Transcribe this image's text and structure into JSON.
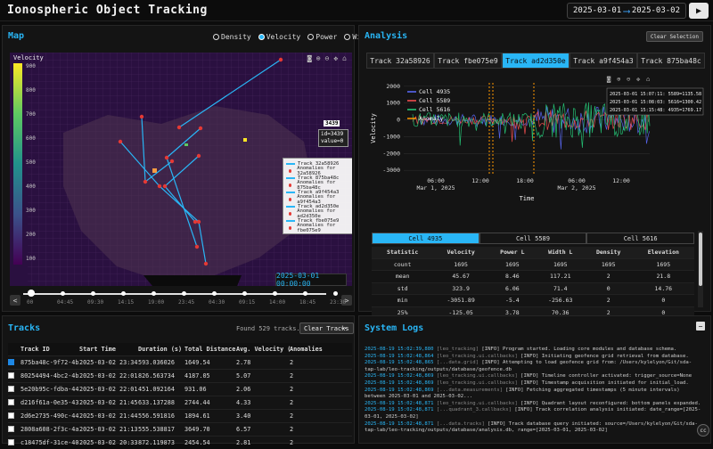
{
  "app": {
    "title": "Ionospheric Object Tracking"
  },
  "date_range": {
    "start": "2025-03-01",
    "end": "2025-03-02"
  },
  "map": {
    "title": "Map",
    "modes": [
      {
        "label": "Density",
        "selected": false
      },
      {
        "label": "Velocity",
        "selected": true
      },
      {
        "label": "Power",
        "selected": false
      },
      {
        "label": "Width",
        "selected": false
      }
    ],
    "colorbar_label": "Velocity",
    "colorbar_ticks": [
      "900",
      "800",
      "700",
      "600",
      "500",
      "400",
      "300",
      "200",
      "100"
    ],
    "tooltip": {
      "head": "3439",
      "line1": "id=3439",
      "line2": "value=0"
    },
    "legend": [
      {
        "label": "Track 32a58926",
        "kind": "line"
      },
      {
        "label": "Anomalies for 32a58926",
        "kind": "dot"
      },
      {
        "label": "Track 875ba48c",
        "kind": "line"
      },
      {
        "label": "Anomalies for 875ba48c",
        "kind": "dot"
      },
      {
        "label": "Track a9f454a3",
        "kind": "line"
      },
      {
        "label": "Anomalies for a9f454a3",
        "kind": "dot"
      },
      {
        "label": "Track ad2d350e",
        "kind": "line"
      },
      {
        "label": "Anomalies for ad2d350e",
        "kind": "dot"
      },
      {
        "label": "Track fbe075e9",
        "kind": "line"
      },
      {
        "label": "Anomalies for fbe075e9",
        "kind": "dot"
      }
    ],
    "time_display": "2025-03-01 00:00:00",
    "slider_labels": [
      "00",
      "04:45",
      "09:30",
      "14:15",
      "19:00",
      "23:45",
      "04:30",
      "09:15",
      "14:00",
      "18:45",
      "23:30"
    ],
    "slider_prev": "<",
    "slider_next": ">",
    "colors": {
      "track": "#29b6f6",
      "anomaly": "#e53935"
    }
  },
  "analysis": {
    "title": "Analysis",
    "clear_selection": "Clear Selection",
    "tabs": [
      {
        "label": "Track 32a58926",
        "active": false
      },
      {
        "label": "Track fbe075e9",
        "active": false
      },
      {
        "label": "Track ad2d350e",
        "active": true
      },
      {
        "label": "Track a9f454a3",
        "active": false
      },
      {
        "label": "Track 875ba48c",
        "active": false
      }
    ],
    "chart_hover": [
      "2025-03-01 15:07:11: 5589=1135.58",
      "2025-03-01 15:08:03: 5616=1300.42",
      "2025-03-01 15:15:48: 4935=1769.17"
    ],
    "cell_tabs": [
      {
        "label": "Cell 4935",
        "active": true
      },
      {
        "label": "Cell 5589",
        "active": false
      },
      {
        "label": "Cell 5616",
        "active": false
      }
    ],
    "stats": {
      "headers": [
        "Statistic",
        "Velocity",
        "Power L",
        "Width L",
        "Density",
        "Elevation"
      ],
      "rows": [
        [
          "count",
          "1695",
          "1695",
          "1695",
          "1695",
          "1695"
        ],
        [
          "mean",
          "45.67",
          "8.46",
          "117.21",
          "2",
          "21.8"
        ],
        [
          "std",
          "323.9",
          "6.06",
          "71.4",
          "0",
          "14.76"
        ],
        [
          "min",
          "-3051.89",
          "-5.4",
          "-256.63",
          "2",
          "0"
        ],
        [
          "25%",
          "-125.05",
          "3.78",
          "70.36",
          "2",
          "0"
        ],
        [
          "50%",
          "39.85",
          "6.88",
          "102.61",
          "2",
          "27.47"
        ],
        [
          "75%",
          "208.18",
          "11.98",
          "146.71",
          "2",
          "31.8"
        ]
      ]
    }
  },
  "chart_data": {
    "type": "line",
    "title": "",
    "xlabel": "Time",
    "ylabel": "Velocity",
    "x_tick_labels": [
      "06:00\nMar 1, 2025",
      "12:00",
      "18:00",
      "06:00\nMar 2, 2025",
      "12:00",
      "18:00"
    ],
    "y_ticks": [
      2000,
      1000,
      0,
      -1000,
      -2000,
      -3000
    ],
    "ylim": [
      -3200,
      2200
    ],
    "legend_placement": "top-left",
    "series": [
      {
        "name": "Cell 4935",
        "color": "#5c6bff"
      },
      {
        "name": "Cell 5589",
        "color": "#ff5252"
      },
      {
        "name": "Cell 5616",
        "color": "#26d07c"
      },
      {
        "name": "Anomaly",
        "color": "#ff9800"
      }
    ]
  },
  "tracks": {
    "title": "Tracks",
    "found_text": "Found 529 tracks.",
    "clear_label": "Clear Tracks",
    "more_label": "…",
    "headers": [
      "",
      "Track ID",
      "Start Time",
      "Duration (s)",
      "Total Distance (k",
      "Avg. Velocity (km",
      "Anomalies",
      ""
    ],
    "rows": [
      {
        "checked": true,
        "id": "875ba48c-9f72-4b",
        "start": "2025-03-02 23:34",
        "duration": "593.036026",
        "distance": "1649.54",
        "velocity": "2.78",
        "anomalies": "2"
      },
      {
        "checked": false,
        "id": "80254494-4bc2-4b",
        "start": "2025-03-02 22:01",
        "duration": "826.563734",
        "distance": "4187.05",
        "velocity": "5.07",
        "anomalies": "2"
      },
      {
        "checked": false,
        "id": "5e20b95c-fdba-44",
        "start": "2025-03-02 22:01",
        "duration": "451.092164",
        "distance": "931.06",
        "velocity": "2.06",
        "anomalies": "2"
      },
      {
        "checked": false,
        "id": "d216f61a-0e35-43",
        "start": "2025-03-02 21:45",
        "duration": "633.137288",
        "distance": "2744.44",
        "velocity": "4.33",
        "anomalies": "2"
      },
      {
        "checked": false,
        "id": "2d6e2735-490c-44",
        "start": "2025-03-02 21:44",
        "duration": "556.591816",
        "distance": "1894.61",
        "velocity": "3.40",
        "anomalies": "2"
      },
      {
        "checked": false,
        "id": "2808a608-2f3c-4a",
        "start": "2025-03-02 21:13",
        "duration": "555.538817",
        "distance": "3649.70",
        "velocity": "6.57",
        "anomalies": "2"
      },
      {
        "checked": false,
        "id": "c18475df-31ce-40",
        "start": "2025-03-02 20:33",
        "duration": "872.119873",
        "distance": "2454.54",
        "velocity": "2.81",
        "anomalies": "2"
      }
    ]
  },
  "logs": {
    "title": "System Logs",
    "minimize": "−",
    "entries": [
      {
        "ts": "2025-08-19 15:02:39,880",
        "src": "[leo_tracking]",
        "msg": " [INFO] Program started. Loading core modules and database schema."
      },
      {
        "ts": "2025-08-19 15:02:48,864",
        "src": "[leo_tracking.ui.callbacks]",
        "msg": " [INFO] Initiating geofence grid retrieval from database."
      },
      {
        "ts": "2025-08-19 15:02:48,865",
        "src": "[...data.grid]",
        "msg": " [INFO] Attempting to load geofence grid from: /Users/kylelyon/Git/sda-tap-lab/leo-tracking/outputs/database/geofence.db"
      },
      {
        "ts": "2025-08-19 15:02:48,869",
        "src": "[leo_tracking.ui.callbacks]",
        "msg": " [INFO] Timeline controller activated: trigger_source=None"
      },
      {
        "ts": "2025-08-19 15:02:48,869",
        "src": "[leo_tracking.ui.callbacks]",
        "msg": " [INFO] Timestamp acquisition initiated for initial_load."
      },
      {
        "ts": "2025-08-19 15:02:48,869",
        "src": "[...data.measurements]",
        "msg": " [INFO] Fetching aggregated timestamps (5 minute intervals) between 2025-03-01 and 2025-03-02..."
      },
      {
        "ts": "2025-08-19 15:02:48,871",
        "src": "[leo_tracking.ui.callbacks]",
        "msg": " [INFO] Quadrant layout reconfigured: bottom panels expanded."
      },
      {
        "ts": "2025-08-19 15:02:48,871",
        "src": "[...quadrant_3.callbacks]",
        "msg": " [INFO] Track correlation analysis initiated: date_range=[2025-03-01, 2025-03-02]"
      },
      {
        "ts": "2025-08-19 15:02:48,871",
        "src": "[...data.tracks]",
        "msg": " [INFO] Track database query initiated: source=/Users/kylelyon/Git/sda-tap-lab/leo-tracking/outputs/database/analysis.db, range=[2025-03-01, 2025-03-02]"
      }
    ]
  },
  "fab_label": "cc"
}
